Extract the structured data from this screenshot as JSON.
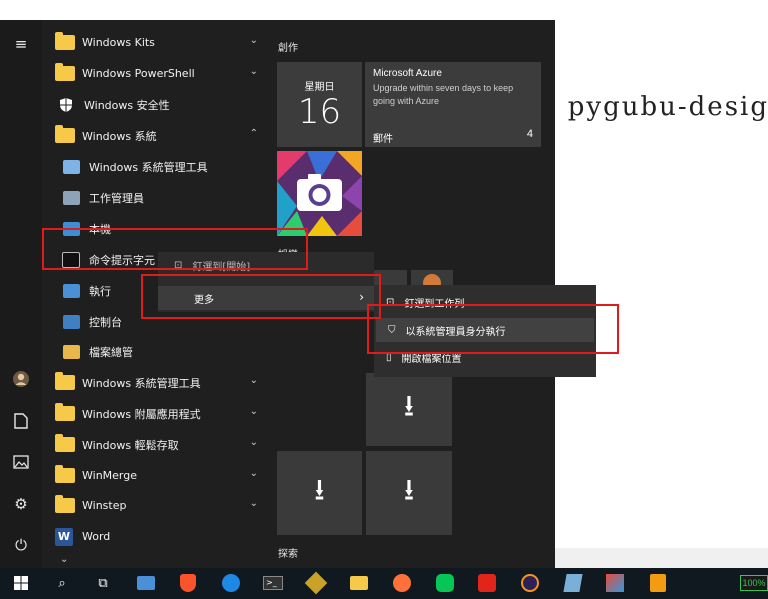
{
  "background": {
    "editor_text": "a pygubu-desig"
  },
  "applist": {
    "items": [
      {
        "label": "Windows Kits",
        "kind": "folder",
        "chevron": "⌄"
      },
      {
        "label": "Windows PowerShell",
        "kind": "folder",
        "chevron": "⌄"
      },
      {
        "label": "Windows 安全性",
        "kind": "shield",
        "chevron": ""
      },
      {
        "label": "Windows 系統",
        "kind": "folder",
        "chevron": "⌃"
      },
      {
        "label": "Windows 系統管理工具",
        "kind": "sub",
        "chevron": ""
      },
      {
        "label": "工作管理員",
        "kind": "sub",
        "chevron": ""
      },
      {
        "label": "本機",
        "kind": "sub",
        "chevron": ""
      },
      {
        "label": "命令提示字元",
        "kind": "sub",
        "chevron": ""
      },
      {
        "label": "執行",
        "kind": "sub",
        "chevron": ""
      },
      {
        "label": "控制台",
        "kind": "sub",
        "chevron": ""
      },
      {
        "label": "檔案總管",
        "kind": "sub",
        "chevron": ""
      },
      {
        "label": "Windows 系統管理工具",
        "kind": "folder",
        "chevron": "⌄"
      },
      {
        "label": "Windows 附屬應用程式",
        "kind": "folder",
        "chevron": "⌄"
      },
      {
        "label": "Windows 輕鬆存取",
        "kind": "folder",
        "chevron": "⌄"
      },
      {
        "label": "WinMerge",
        "kind": "folder",
        "chevron": "⌄"
      },
      {
        "label": "Winstep",
        "kind": "folder",
        "chevron": "⌄"
      },
      {
        "label": "Word",
        "kind": "word",
        "chevron": ""
      }
    ]
  },
  "tiles": {
    "group1": "創作",
    "group2": "娛樂",
    "group3": "探索",
    "calendar": {
      "day": "星期日",
      "date": "16"
    },
    "mail": {
      "title": "Microsoft Azure",
      "body": "Upgrade within seven days to keep going with Azure",
      "label": "郵件",
      "count": "4"
    }
  },
  "context_menu_1": {
    "pin_start": "釘選到[開始]",
    "more": "更多"
  },
  "context_menu_2": {
    "pin_taskbar": "釘選到工作列",
    "run_admin": "以系統管理員身分執行",
    "open_location": "開啟檔案位置"
  },
  "taskbar": {
    "battery": "100%"
  },
  "colors": {
    "accent": "#e01b1b",
    "tile": "#3a3a3a",
    "start_bg": "#1f1f1f"
  }
}
